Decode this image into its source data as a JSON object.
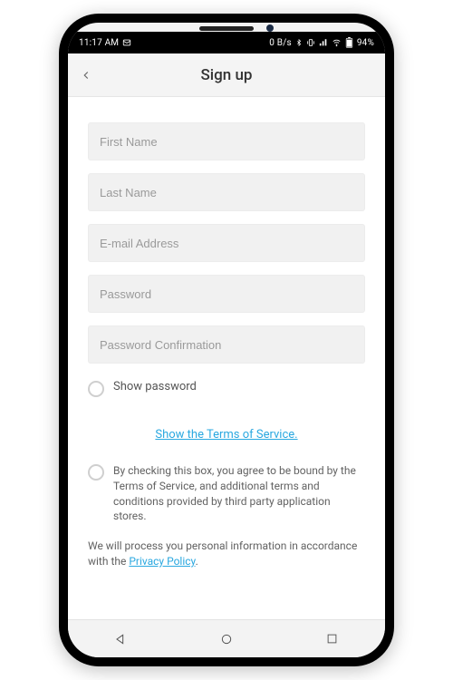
{
  "statusbar": {
    "time": "11:17 AM",
    "data_rate": "0 B/s",
    "battery": "94%"
  },
  "appbar": {
    "title": "Sign up"
  },
  "form": {
    "first_name_placeholder": "First Name",
    "last_name_placeholder": "Last Name",
    "email_placeholder": "E-mail Address",
    "password_placeholder": "Password",
    "password_confirm_placeholder": "Password Confirmation",
    "show_password_label": "Show password"
  },
  "links": {
    "tos_link": "Show the Terms of Service.",
    "privacy_policy": "Privacy Policy"
  },
  "agree": {
    "text": "By checking this box, you agree to be bound by the Terms of Service, and additional terms and conditions provided by third party application stores."
  },
  "process": {
    "prefix": "We will process you personal information in accordance with the ",
    "suffix": "."
  },
  "colors": {
    "link": "#2aa8e0",
    "field_bg": "#f1f1f1"
  }
}
